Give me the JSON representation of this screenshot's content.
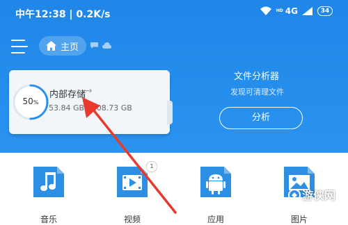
{
  "statusbar": {
    "time": "中午12:38 | 0.2K/s",
    "hd": "HD",
    "network": "4G",
    "battery": "34"
  },
  "header": {
    "home_label": "主页"
  },
  "storage": {
    "percent": "50",
    "percent_unit": "%",
    "title": "内部存储",
    "usage": "53.84 GB / 108.73 GB"
  },
  "analyzer": {
    "title": "文件分析器",
    "subtitle": "发现可清理文件",
    "button_label": "分析"
  },
  "categories": [
    {
      "label": "音乐",
      "icon": "music-icon"
    },
    {
      "label": "视频",
      "icon": "video-icon",
      "badge": "1"
    },
    {
      "label": "应用",
      "icon": "android-icon"
    },
    {
      "label": "图片",
      "icon": "picture-icon"
    }
  ],
  "colors": {
    "primary": "#2a8ff0",
    "icon_blue": "#2d8fe3",
    "annotation": "#e8392c"
  },
  "watermark": {
    "text": "游侠网"
  }
}
